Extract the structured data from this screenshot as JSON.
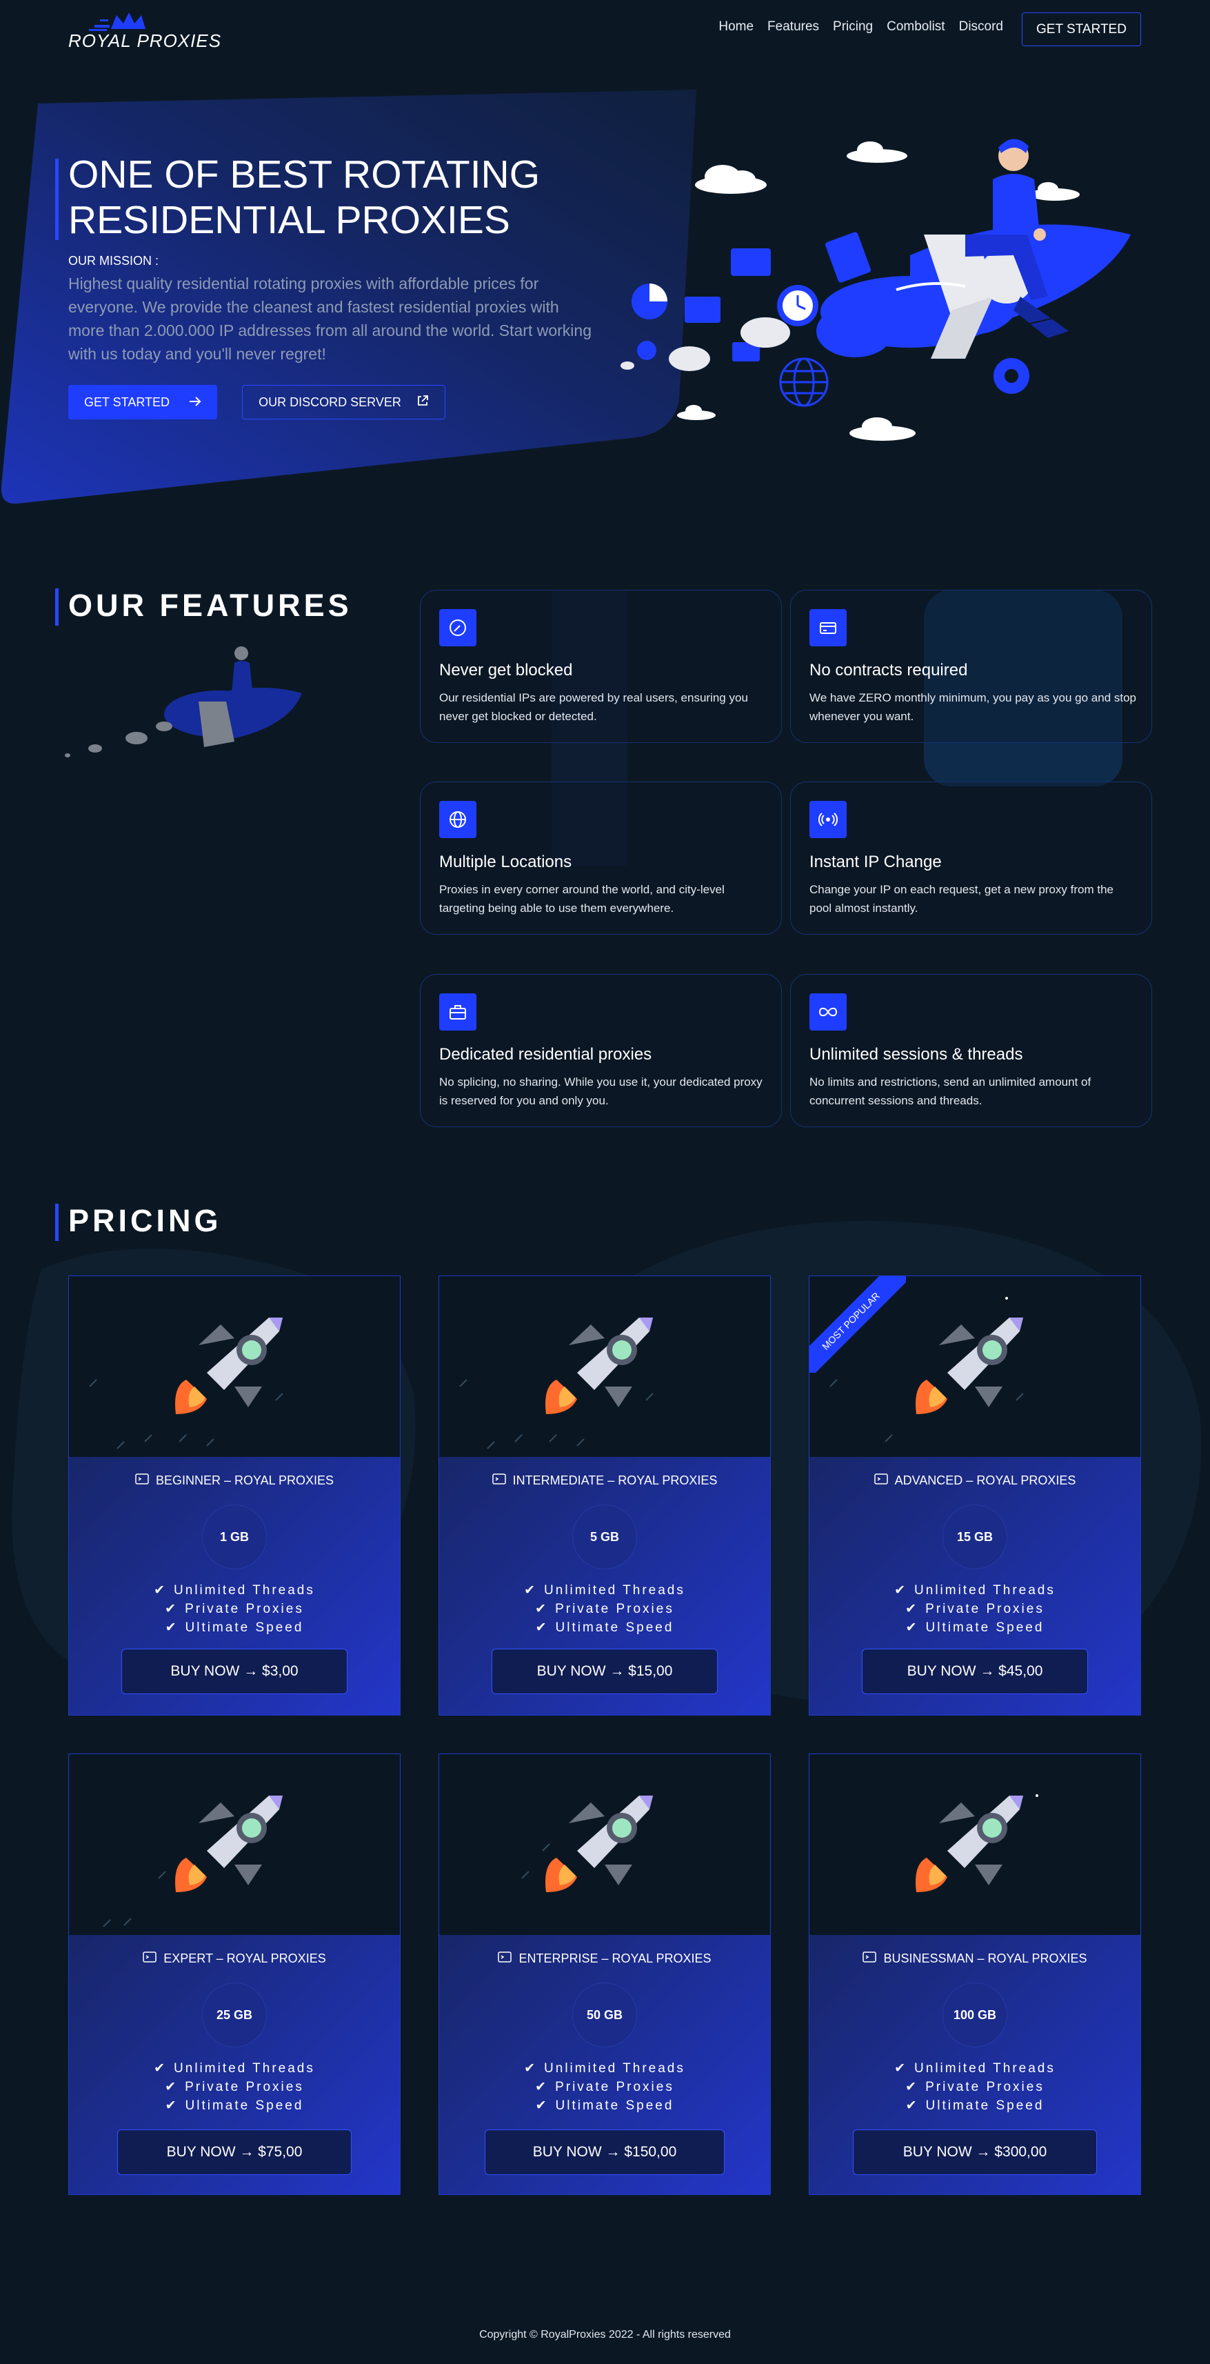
{
  "brand": {
    "name": "ROYAL PROXIES",
    "accent": "#1f3dff",
    "background": "#0b1824"
  },
  "nav": {
    "links": [
      "Home",
      "Features",
      "Pricing",
      "Combolist",
      "Discord"
    ],
    "cta": "GET STARTED"
  },
  "hero": {
    "title_line1": "ONE OF BEST ROTATING",
    "title_line2": "RESIDENTIAL PROXIES",
    "mission_label": "OUR MISSION :",
    "mission_text": "Highest quality residential rotating proxies with affordable prices for everyone. We provide the cleanest and fastest residential proxies with more than 2.000.000 IP addresses from all around the world. Start working with us today and you'll never regret!",
    "primary_button": "GET STARTED",
    "secondary_button": "OUR DISCORD SERVER"
  },
  "features": {
    "title": "OUR FEATURES",
    "items": [
      {
        "icon": "compass-icon",
        "title": "Never get blocked",
        "text": "Our residential IPs are powered by real users, ensuring you never get blocked or detected."
      },
      {
        "icon": "credit-card-icon",
        "title": "No contracts required",
        "text": "We have ZERO monthly minimum, you pay as you go and stop whenever you want."
      },
      {
        "icon": "globe-icon",
        "title": "Multiple Locations",
        "text": "Proxies in every corner around the world, and city-level targeting being able to use them everywhere."
      },
      {
        "icon": "broadcast-icon",
        "title": "Instant IP Change",
        "text": "Change your IP on each request, get a new proxy from the pool almost instantly."
      },
      {
        "icon": "briefcase-icon",
        "title": "Dedicated residential proxies",
        "text": "No splicing, no sharing. While you use it, your dedicated proxy is reserved for you and only you."
      },
      {
        "icon": "infinity-icon",
        "title": "Unlimited sessions & threads",
        "text": "No limits and restrictions, send an unlimited amount of concurrent sessions and threads."
      }
    ]
  },
  "pricing": {
    "title": "PRICING",
    "ribbon": "MOST POPULAR",
    "features": [
      "Unlimited Threads",
      "Private Proxies",
      "Ultimate Speed"
    ],
    "plans": [
      {
        "name": "BEGINNER – ROYAL PROXIES",
        "size": "1 GB",
        "button": "BUY NOW → $3,00"
      },
      {
        "name": "INTERMEDIATE – ROYAL PROXIES",
        "size": "5 GB",
        "button": "BUY NOW → $15,00"
      },
      {
        "name": "ADVANCED – ROYAL PROXIES",
        "size": "15 GB",
        "button": "BUY NOW → $45,00"
      },
      {
        "name": "EXPERT – ROYAL PROXIES",
        "size": "25 GB",
        "button": "BUY NOW → $75,00"
      },
      {
        "name": "ENTERPRISE – ROYAL PROXIES",
        "size": "50 GB",
        "button": "BUY NOW → $150,00"
      },
      {
        "name": "BUSINESSMAN – ROYAL PROXIES",
        "size": "100 GB",
        "button": "BUY NOW → $300,00"
      }
    ]
  },
  "footer": {
    "text": "Copyright © RoyalProxies 2022 - All rights reserved"
  }
}
